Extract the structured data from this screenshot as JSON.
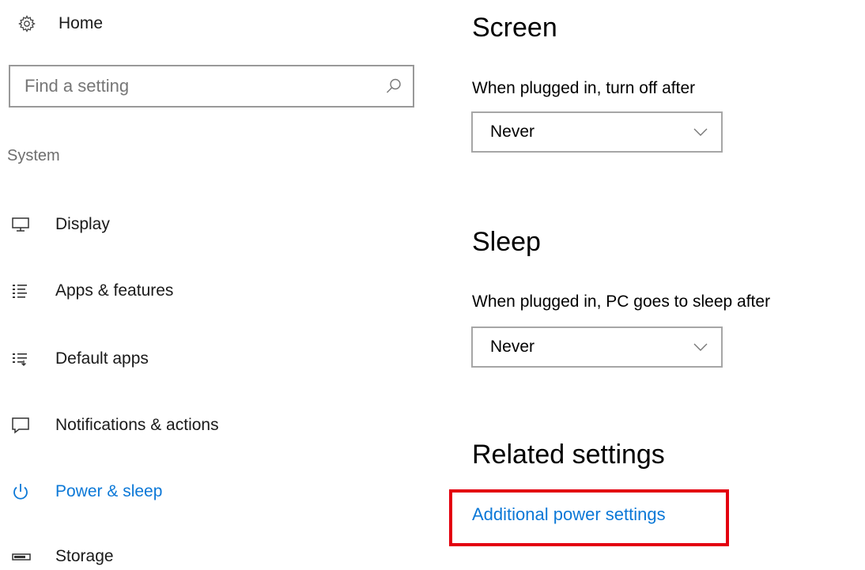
{
  "sidebar": {
    "home_label": "Home",
    "search": {
      "placeholder": "Find a setting",
      "value": ""
    },
    "section_label": "System",
    "items": [
      {
        "label": "Display",
        "icon": "monitor-icon"
      },
      {
        "label": "Apps & features",
        "icon": "apps-list-icon"
      },
      {
        "label": "Default apps",
        "icon": "default-apps-icon"
      },
      {
        "label": "Notifications & actions",
        "icon": "notification-icon"
      },
      {
        "label": "Power & sleep",
        "icon": "power-icon",
        "active": true
      },
      {
        "label": "Storage",
        "icon": "storage-icon"
      }
    ]
  },
  "main": {
    "screen": {
      "title": "Screen",
      "plugged_label": "When plugged in, turn off after",
      "plugged_value": "Never"
    },
    "sleep": {
      "title": "Sleep",
      "plugged_label": "When plugged in, PC goes to sleep after",
      "plugged_value": "Never"
    },
    "related": {
      "title": "Related settings",
      "link_label": "Additional power settings"
    }
  },
  "colors": {
    "accent": "#0b78d7",
    "highlight_box": "#e3000f",
    "border": "#a6a6a6",
    "muted_text": "#6e6e6e"
  }
}
